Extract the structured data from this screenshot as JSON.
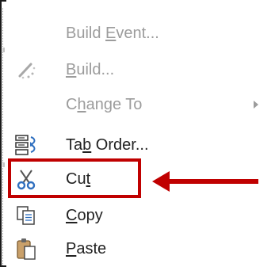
{
  "menu": {
    "items": [
      {
        "pre": "Build ",
        "accel": "E",
        "post": "vent...",
        "icon": "none",
        "enabled": false,
        "submenu": false
      },
      {
        "pre": "",
        "accel": "B",
        "post": "uild...",
        "icon": "build-wand-icon",
        "enabled": false,
        "submenu": false
      },
      {
        "pre": "C",
        "accel": "h",
        "post": "ange To",
        "icon": "none",
        "enabled": false,
        "submenu": true
      },
      {
        "pre": "Ta",
        "accel": "b",
        "post": " Order...",
        "icon": "tab-order-icon",
        "enabled": true,
        "submenu": false
      },
      {
        "pre": "Cu",
        "accel": "t",
        "post": "",
        "icon": "scissors-icon",
        "enabled": true,
        "submenu": false
      },
      {
        "pre": "",
        "accel": "C",
        "post": "opy",
        "icon": "copy-icon",
        "enabled": true,
        "submenu": false
      },
      {
        "pre": "",
        "accel": "P",
        "post": "aste",
        "icon": "paste-icon",
        "enabled": true,
        "submenu": false
      }
    ]
  },
  "annotation": {
    "color": "#c00000",
    "target": "Cut"
  },
  "colors": {
    "disabled_text": "#9c9c9c",
    "text": "#222222",
    "icon_blue": "#2f6fbf"
  }
}
